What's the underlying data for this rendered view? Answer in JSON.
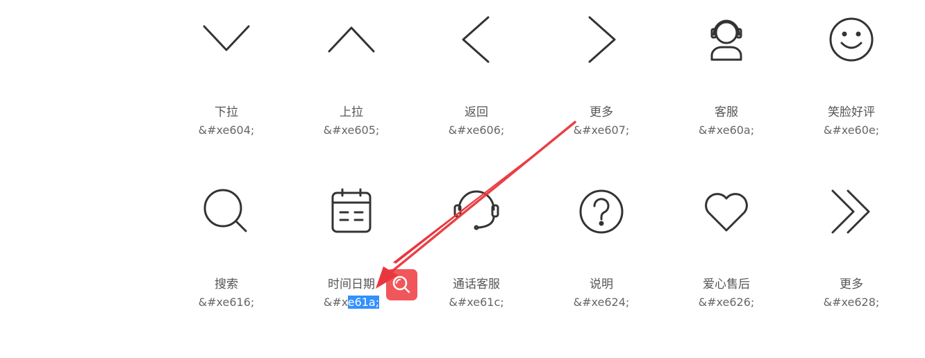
{
  "icons_row1": [
    {
      "name": "下拉",
      "code_prefix": "&#xe604;",
      "code_selected": "",
      "icon": "chevron-down-icon"
    },
    {
      "name": "上拉",
      "code_prefix": "&#xe605;",
      "code_selected": "",
      "icon": "chevron-up-icon"
    },
    {
      "name": "返回",
      "code_prefix": "&#xe606;",
      "code_selected": "",
      "icon": "chevron-left-icon"
    },
    {
      "name": "更多",
      "code_prefix": "&#xe607;",
      "code_selected": "",
      "icon": "chevron-right-icon"
    },
    {
      "name": "客服",
      "code_prefix": "&#xe60a;",
      "code_selected": "",
      "icon": "customer-service-icon"
    },
    {
      "name": "笑脸好评",
      "code_prefix": "&#xe60e;",
      "code_selected": "",
      "icon": "smiley-icon"
    }
  ],
  "icons_row2": [
    {
      "name": "搜索",
      "code_prefix": "&#xe616;",
      "code_selected": "",
      "icon": "search-icon"
    },
    {
      "name": "时间日期",
      "code_prefix": "&#x",
      "code_selected": "e61a;",
      "icon": "calendar-icon"
    },
    {
      "name": "通话客服",
      "code_prefix": "&#xe61c;",
      "code_selected": "",
      "icon": "headset-icon"
    },
    {
      "name": "说明",
      "code_prefix": "&#xe624;",
      "code_selected": "",
      "icon": "question-circle-icon"
    },
    {
      "name": "爱心售后",
      "code_prefix": "&#xe626;",
      "code_selected": "",
      "icon": "heart-icon"
    },
    {
      "name": "更多",
      "code_prefix": "&#xe628;",
      "code_selected": "",
      "icon": "double-chevron-right-icon"
    }
  ],
  "colors": {
    "icon_stroke": "#333333",
    "selection": "#3390ff",
    "search_button": "#f1565a",
    "arrow": "#e8373d"
  },
  "overlay": {
    "search_button_icon": "search-icon"
  }
}
